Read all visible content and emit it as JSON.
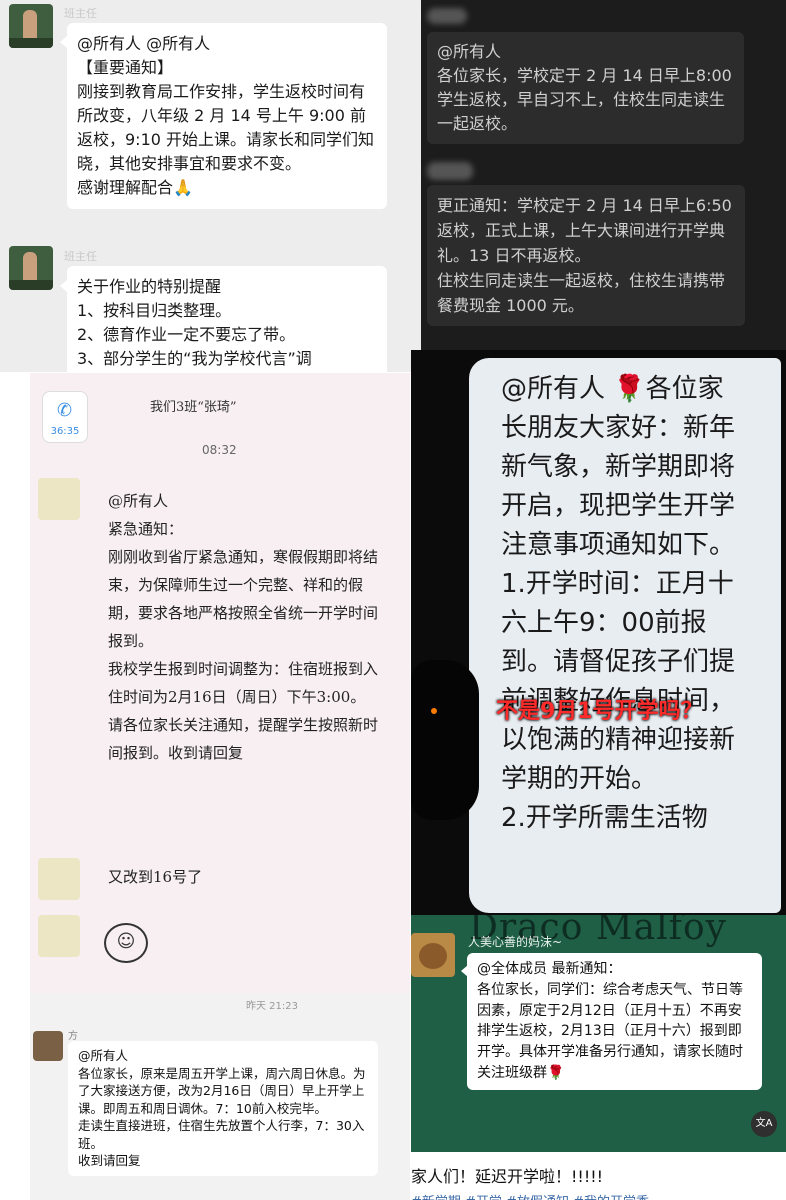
{
  "colors": {
    "light_bg": "#ededed",
    "dark_bg": "#1c1c1c",
    "dark_bubble": "#2c2c2c",
    "white": "#ffffff",
    "paper_bg": "#f7eff1",
    "phone_bg": "#0b0b0b",
    "green_bg": "#1f5f46",
    "alert_red": "#ff2a2a"
  },
  "panel_top_left": {
    "sender1": "班主任",
    "message1": "@所有人  @所有人\n【重要通知】\n刚接到教育局工作安排，学生返校时间有所改变，八年级 2 月 14 号上午 9:00 前返校，9:10 开始上课。请家长和同学们知晓，其他安排事宜和要求不变。\n感谢理解配合🙏",
    "sender2": "班主任",
    "message2": "关于作业的特别提醒\n1、按科目归类整理。\n2、德育作业一定不要忘了带。\n3、部分学生的“我为学校代言”调"
  },
  "panel_top_right": {
    "message1": "@所有人\n各位家长，学校定于 2 月 14 日早上8:00 学生返校，早自习不上，住校生同走读生一起返校。",
    "message2": "更正通知：学校定于 2 月 14 日早上6:50 返校，正式上课，上午大课间进行开学典礼。13 日不再返校。\n住校生同走读生一起返校，住校生请携带餐费现金 1000 元。"
  },
  "panel_mid_left": {
    "call_icon_label": "36:35",
    "chat_title": "我们3班“张琦”",
    "time": "08:32",
    "message1": "@所有人\n紧急通知：\n    刚刚收到省厅紧急通知，寒假假期即将结束，为保障师生过一个完整、祥和的假期，要求各地严格按照全省统一开学时间报到。\n        我校学生报到时间调整为：住宿班报到入住时间为2月16日（周日）下午3:00。\n    请各位家长关注通知，提醒学生按照新时间报到。收到请回复",
    "message2": "又改到16号了"
  },
  "panel_mid_right": {
    "message": "@所有人 🌹各位家长朋友大家好：新年新气象，新学期即将开启，现把学生开学注意事项通知如下。\n1.开学时间：正月十六上午9：00前报到。请督促孩子们提前调整好作息时间，以饱满的精神迎接新学期的开始。\n2.开学所需生活物",
    "overlay": "不是9月1号开学吗？"
  },
  "panel_bottom_left": {
    "time": "昨天 21:23",
    "sender": "方",
    "message": "@所有人\n各位家长，原来是周五开学上课，周六周日休息。为了大家接送方便，改为2月16日（周日）早上开学上课。即周五和周日调休。7：10前入校完毕。\n走读生直接进班，住宿生先放置个人行李，7：30入班。\n收到请回复"
  },
  "panel_bottom_right": {
    "bg_text": "Draco Malfoy",
    "sender": "人美心善的妈沫~",
    "message": "@全体成员 最新通知：\n各位家长，同学们：综合考虑天气、节日等因素，原定于2月12日（正月十五）不再安排学生返校，2月13日（正月十六）报到即开学。具体开学准备另行通知，请家长随时关注班级群🌹",
    "translate_badge": "文A",
    "caption": "家人们！延迟开学啦！!!!!!",
    "hashtags": "#新学期  #开学  #放假通知  #我的开学季"
  }
}
